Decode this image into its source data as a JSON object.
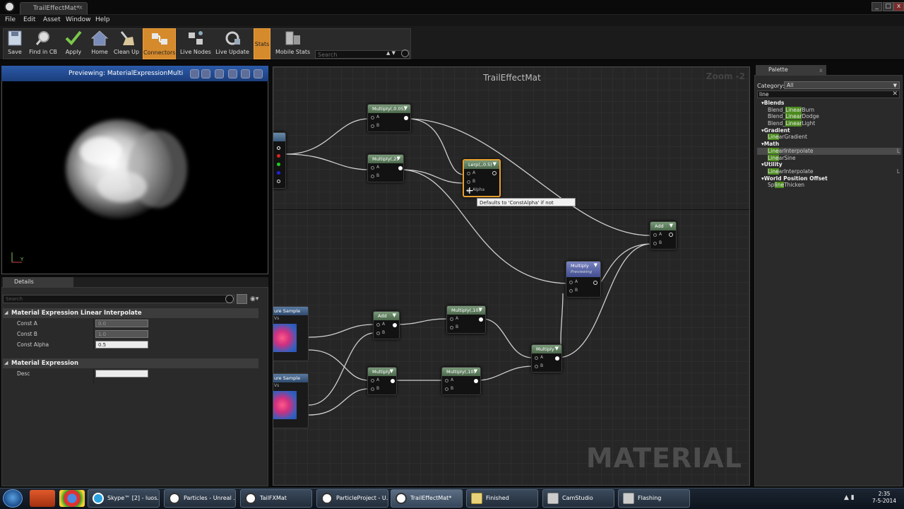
{
  "window": {
    "tab_title": "TrailEffectMat*",
    "tab_close": "x",
    "min": "_",
    "max": "□",
    "close": "x"
  },
  "menu": [
    "File",
    "Edit",
    "Asset",
    "Window",
    "Help"
  ],
  "toolbar": {
    "buttons": [
      "Save",
      "Find in CB",
      "Apply",
      "Home",
      "Clean Up",
      "Connectors",
      "Live Nodes",
      "Live Update",
      "Stats",
      "Mobile Stats"
    ],
    "search_placeholder": "Search"
  },
  "preview": {
    "header": "Previewing: MaterialExpressionMulti"
  },
  "details": {
    "tab": "Details",
    "search_placeholder": "Search",
    "section1": "Material Expression Linear Interpolate",
    "rows": [
      {
        "label": "Const A",
        "value": "0.0"
      },
      {
        "label": "Const B",
        "value": "1.0"
      },
      {
        "label": "Const Alpha",
        "value": "0.5"
      }
    ],
    "section2": "Material Expression",
    "desc_label": "Desc"
  },
  "graph": {
    "title": "TrailEffectMat",
    "zoom": "Zoom -2",
    "watermark": "MATERIAL",
    "tooltip": "Defaults to 'ConstAlpha' if not specified",
    "nodes": {
      "mul005": "Multiply(,0.05)",
      "mul2": "Multiply(,2)",
      "lerp": "Lerp(,,0.5)",
      "add_top": "Add",
      "mul_prev": "Multiply",
      "mul_prev_sub": "Previewing",
      "add_mid": "Add",
      "mul10a": "Multiply(,10)",
      "mul_mid": "Multiply",
      "mul10b": "Multiply(,10)",
      "mul_right": "Multiply",
      "tex1": "ure Sample",
      "tex2": "ure Sample"
    },
    "pins": {
      "a": "A",
      "b": "B",
      "alpha": "Alpha"
    }
  },
  "palette": {
    "tab": "Palette",
    "category_label": "Category:",
    "category_value": "All",
    "search_value": "line",
    "list": [
      {
        "type": "cat",
        "text": "Blends"
      },
      {
        "type": "item",
        "pre": "Blend_",
        "hl": "Linear",
        "post": "Burn"
      },
      {
        "type": "item",
        "pre": "Blend_",
        "hl": "Linear",
        "post": "Dodge"
      },
      {
        "type": "item",
        "pre": "Blend_",
        "hl": "Linear",
        "post": "Light"
      },
      {
        "type": "cat",
        "text": "Gradient"
      },
      {
        "type": "item",
        "pre": "",
        "hl": "Line",
        "post": "arGradient"
      },
      {
        "type": "cat",
        "text": "Math"
      },
      {
        "type": "item",
        "pre": "",
        "hl": "Line",
        "post": "arInterpolate",
        "sel": true,
        "sub": "L"
      },
      {
        "type": "item",
        "pre": "",
        "hl": "Line",
        "post": "arSine"
      },
      {
        "type": "cat",
        "text": "Utility"
      },
      {
        "type": "item",
        "pre": "",
        "hl": "Line",
        "post": "arInterpolate",
        "sub": "L"
      },
      {
        "type": "cat",
        "text": "World Position Offset"
      },
      {
        "type": "item",
        "pre": "Sp",
        "hl": "line",
        "post": "Thicken"
      }
    ]
  },
  "taskbar": {
    "tasks": [
      "Skype™ [2] - luos...",
      "Particles - Unreal ...",
      "TailFXMat",
      "ParticleProject - U...",
      "TrailEffectMat*",
      "Finished",
      "CamStudio",
      "Flashing"
    ],
    "time": "2:35",
    "date": "7-5-2014"
  },
  "colors": {
    "accent_orange": "#d58a2c",
    "node_header_green": "#5e7e5e",
    "node_header_blue": "#5a64aa",
    "palette_highlight": "#4b8a1e",
    "preview_header": "#2b5aa8"
  }
}
